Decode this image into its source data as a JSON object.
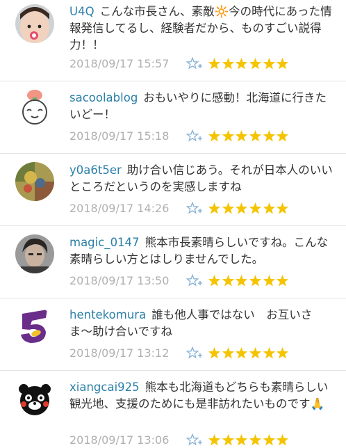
{
  "comments": [
    {
      "username": "U4Q",
      "body": "こんな市長さん、素敵🔆今の時代にあった情報発信してるし、経験者だから、ものすごい説得力！！",
      "timestamp": "2018/09/17 15:57",
      "rating": 6,
      "avatar": "baby-photo"
    },
    {
      "username": "sacoolablog",
      "body": "おもいやりに感動！北海道に行きたいどー！",
      "timestamp": "2018/09/17 15:18",
      "rating": 6,
      "avatar": "cartoon-face"
    },
    {
      "username": "y0a6t5er",
      "body": "助け合い信じあう。それが日本人のいいところだというのを実感しますね",
      "timestamp": "2018/09/17 14:26",
      "rating": 6,
      "avatar": "colorful-photo"
    },
    {
      "username": "magic_0147",
      "body": "熊本市長素晴らしいですね。こんな素晴らしい方とはしりませんでした。",
      "timestamp": "2018/09/17 13:50",
      "rating": 6,
      "avatar": "man-photo"
    },
    {
      "username": "hentekomura",
      "body": "誰も他人事ではない　お互いさま〜助け合いですね",
      "timestamp": "2018/09/17 13:12",
      "rating": 6,
      "avatar": "purple-logo"
    },
    {
      "username": "xiangcai925",
      "body": "熊本も北海道もどちらも素晴らしい観光地、支援のためにも是非訪れたいものです🙏",
      "timestamp": "2018/09/17 13:06",
      "rating": 6,
      "avatar": "kumamon"
    }
  ],
  "colors": {
    "username": "#2b7fa8",
    "timestamp": "#b0b0b0",
    "star": "#f5c400",
    "fav_icon": "#8ab4d8"
  }
}
